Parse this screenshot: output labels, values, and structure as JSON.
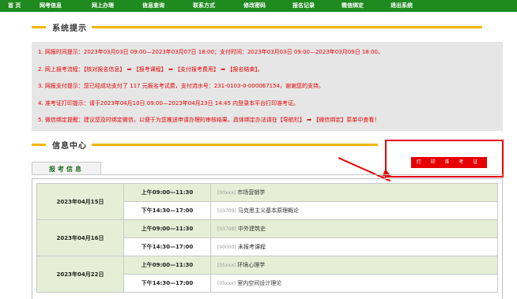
{
  "topnav": {
    "items": [
      "首 页",
      "网考信息",
      "网上办理",
      "信息查询",
      "联系方式",
      "修改密码",
      "报名记录",
      "微信绑定",
      "退出系统"
    ]
  },
  "system_notice": {
    "title": "系统提示",
    "lines": [
      "1. 网报时间提示：2023年03月03日 09:00—2023年03月07日 18:00；支付时间：2023年03月03日 09:00—2023年03月09日 18:00。",
      "2. 网上报考流程：【核对报名信息】 ➡ 【报考课程】 ➡ 【支付报考费用】 ➡ 【报名结束】。",
      "3. 网报支付提示：您已经成功支付了 117 元报名考试费，支付流水号：231-0103-0-000067154，谢谢您的支持。",
      "4. 准考证打印提示：请于2023年04月10日 09:00—2023年04月23日 14:45 内登录本平台打印准考证。",
      "5. 微信绑定提醒：建议您及时绑定微信，以便于为您推送申请办理的审核结果。具体绑定办法请在【导航栏】 ➡ 【微信绑定】菜单中查看！"
    ]
  },
  "info_center": {
    "title": "信息中心",
    "tab_label": "报考信息",
    "print_button": "打 印 准 考 证"
  },
  "exam_schedule": [
    {
      "date": "2023年04月15日",
      "sessions": [
        {
          "time": "上午09:00—11:30",
          "code": "[00xxx]",
          "subject": "市场营销学"
        },
        {
          "time": "下午14:30—17:00",
          "code": "[03709]",
          "subject": "马克思主义基本原理概论"
        }
      ]
    },
    {
      "date": "2023年04月16日",
      "sessions": [
        {
          "time": "上午09:00—11:30",
          "code": "[03708]",
          "subject": "中外建筑史"
        },
        {
          "time": "下午14:30—17:00",
          "code": "[00000]",
          "subject": "未报考课程"
        }
      ]
    },
    {
      "date": "2023年04月22日",
      "sessions": [
        {
          "time": "上午09:00—11:30",
          "code": "[05xxx]",
          "subject": "环境心理学"
        },
        {
          "time": "下午14:30—17:00",
          "code": "[05xxx]",
          "subject": "室内空间设计理论"
        }
      ]
    }
  ]
}
